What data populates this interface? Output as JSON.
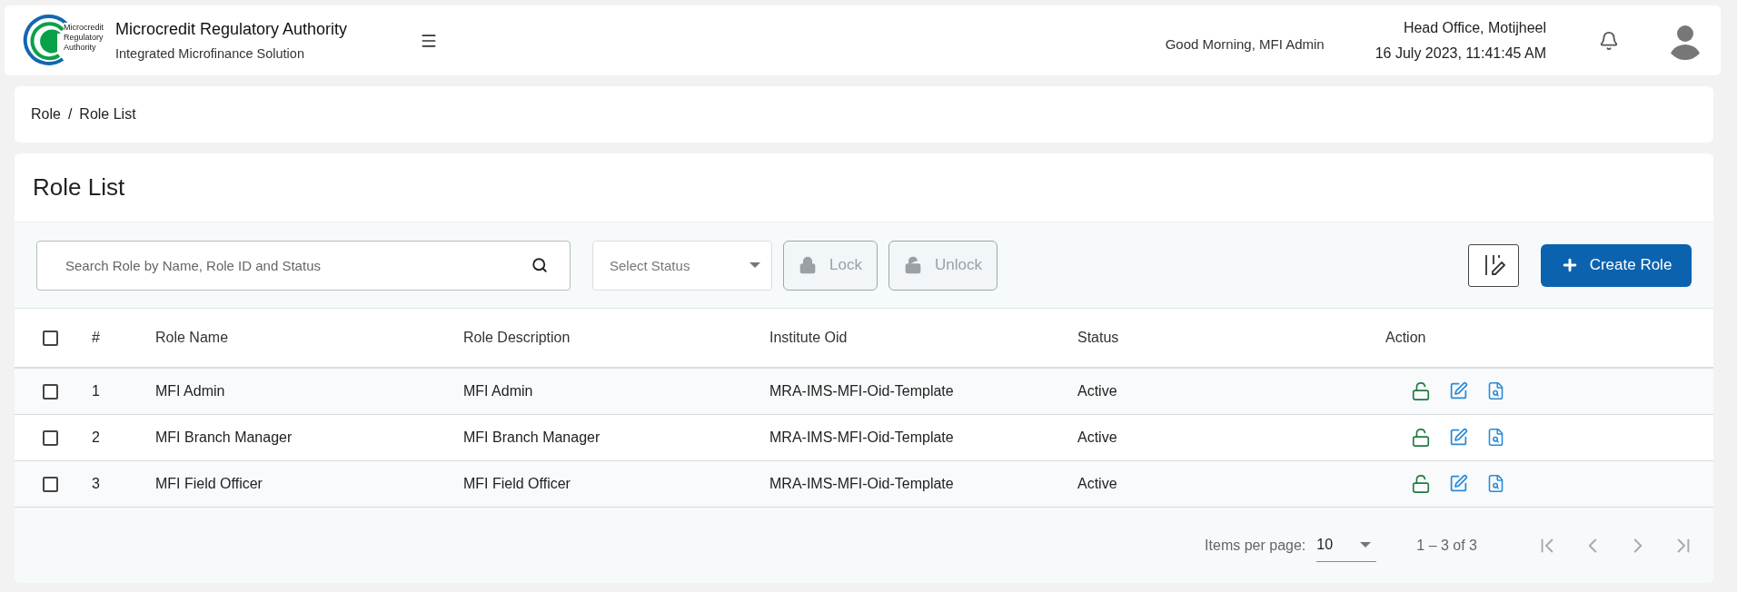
{
  "header": {
    "logo_lines": [
      "Microcredit",
      "Regulatory",
      "Authority"
    ],
    "title": "Microcredit Regulatory Authority",
    "subtitle": "Integrated Microfinance Solution",
    "greeting": "Good Morning, MFI Admin",
    "office": "Head Office, Motijheel",
    "datetime": "16 July 2023, 11:41:45 AM"
  },
  "breadcrumb": [
    "Role",
    "/",
    "Role List"
  ],
  "page_title": "Role List",
  "toolbar": {
    "search": {
      "placeholder": "Search Role by Name, Role ID and Status"
    },
    "status_select": {
      "placeholder": "Select Status"
    },
    "buttons": [
      {
        "kind": "lock",
        "label": "Lock",
        "disabled": true
      },
      {
        "kind": "unlock",
        "label": "Unlock",
        "disabled": true
      }
    ],
    "create_button": "Create Role"
  },
  "table": {
    "header_checked": false,
    "columns": [
      "#",
      "Role Name",
      "Role Description",
      "Institute Oid",
      "Status",
      "Action"
    ],
    "rows": [
      {
        "checked": false,
        "cells": [
          "1",
          "MFI Admin",
          "MFI Admin",
          "MRA-IMS-MFI-Oid-Template",
          "Active"
        ]
      },
      {
        "checked": false,
        "cells": [
          "2",
          "MFI Branch Manager",
          "MFI Branch Manager",
          "MRA-IMS-MFI-Oid-Template",
          "Active"
        ]
      },
      {
        "checked": false,
        "cells": [
          "3",
          "MFI Field Officer",
          "MFI Field Officer",
          "MRA-IMS-MFI-Oid-Template",
          "Active"
        ]
      }
    ]
  },
  "pagination": {
    "label": "Items per page:",
    "page_size": "10",
    "range": "1 – 3 of 3",
    "nav": [
      {
        "kind": "first",
        "disabled": true
      },
      {
        "kind": "prev",
        "disabled": true
      },
      {
        "kind": "next",
        "disabled": true
      },
      {
        "kind": "last",
        "disabled": true
      }
    ]
  }
}
